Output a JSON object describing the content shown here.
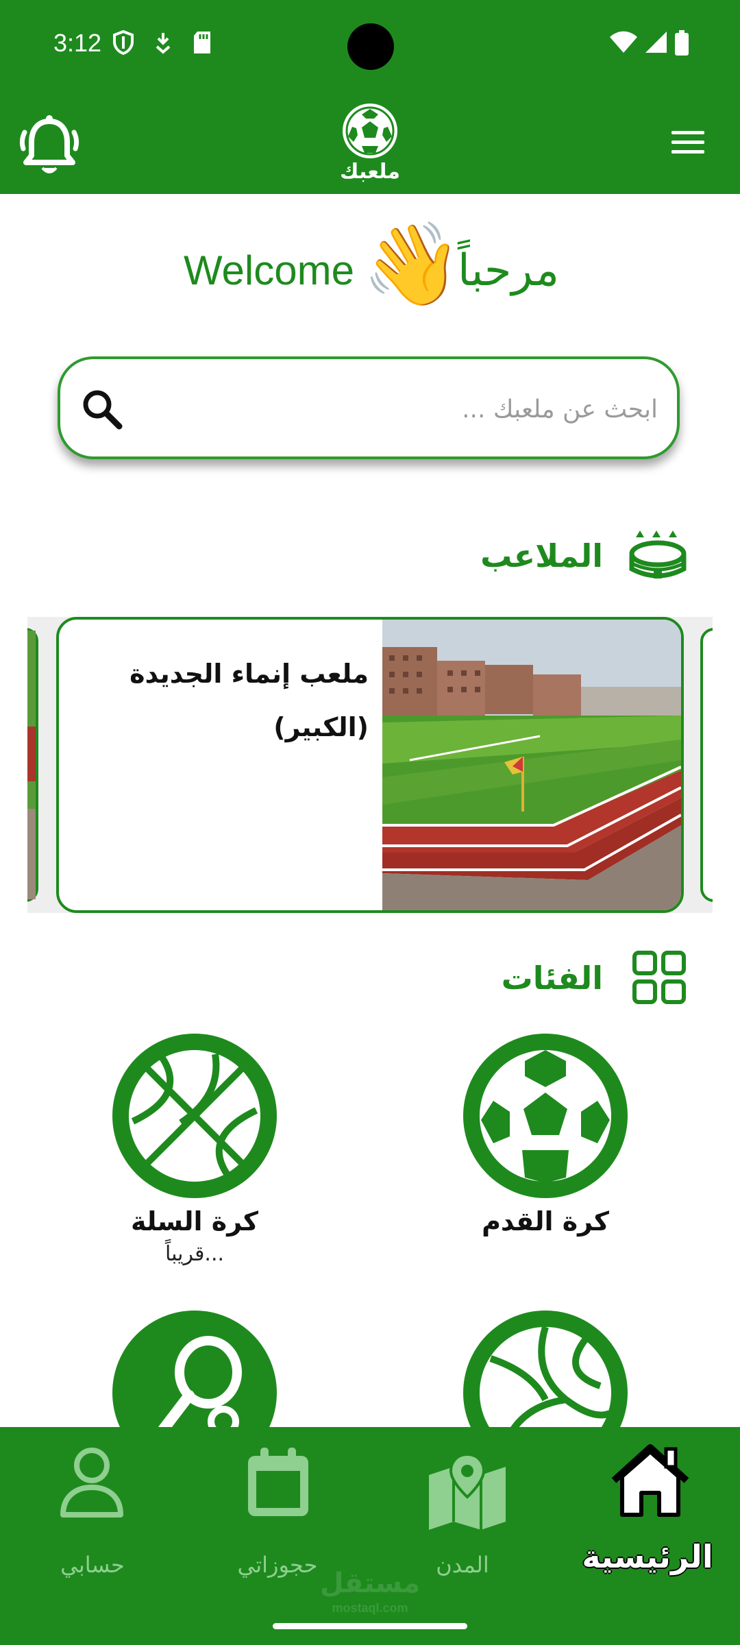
{
  "status": {
    "time": "3:12"
  },
  "header": {
    "logo_text": "ملعبك"
  },
  "welcome": {
    "english": "Welcome",
    "arabic": "مرحباً",
    "emoji": "👋"
  },
  "search": {
    "placeholder": "ابحث عن ملعبك ..."
  },
  "stadiums": {
    "title": "الملاعب",
    "cards": [
      {
        "name_line1": "ملعب إنماء الجديدة",
        "name_line2": "(الكبير)"
      }
    ]
  },
  "categories": {
    "title": "الفئات",
    "items": [
      {
        "label": "كرة القدم",
        "icon": "soccer-ball-icon"
      },
      {
        "label": "كرة السلة",
        "sub": "قريباً...",
        "icon": "basketball-icon"
      },
      {
        "label": "",
        "icon": "volleyball-icon"
      },
      {
        "label": "",
        "icon": "tennis-racket-icon"
      }
    ]
  },
  "nav": {
    "items": [
      {
        "label": "الرئيسية",
        "icon": "home-icon",
        "active": true
      },
      {
        "label": "المدن",
        "icon": "map-icon"
      },
      {
        "label": "حجوزاتي",
        "icon": "calendar-icon"
      },
      {
        "label": "حسابي",
        "icon": "user-icon"
      }
    ],
    "watermark": "مستقل",
    "watermark_url": "mostaql.com"
  },
  "colors": {
    "primary": "#1e8a1e",
    "muted_nav": "#8fcf8f"
  }
}
